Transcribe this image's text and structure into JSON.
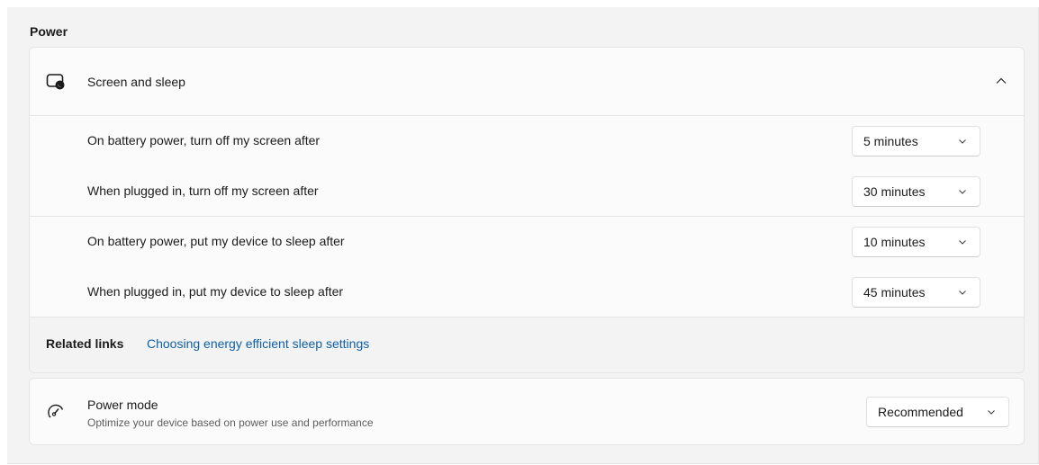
{
  "section": {
    "title": "Power"
  },
  "screen_sleep": {
    "label": "Screen and sleep",
    "header_icon": "screen-sleep-icon",
    "collapse_icon": "chevron-up-icon",
    "rows": [
      {
        "label": "On battery power, turn off my screen after",
        "value": "5 minutes"
      },
      {
        "label": "When plugged in, turn off my screen after",
        "value": "30 minutes"
      },
      {
        "label": "On battery power, put my device to sleep after",
        "value": "10 minutes"
      },
      {
        "label": "When plugged in, put my device to sleep after",
        "value": "45 minutes"
      }
    ],
    "related": {
      "title": "Related links",
      "link": "Choosing energy efficient sleep settings"
    }
  },
  "power_mode": {
    "title": "Power mode",
    "subtitle": "Optimize your device based on power use and performance",
    "value": "Recommended",
    "icon": "power-mode-gauge-icon"
  },
  "colors": {
    "background": "#f3f3f3",
    "card": "#fbfbfb",
    "link": "#0f5fa8",
    "text": "#1b1b1b",
    "secondary_text": "#5d5d5d"
  }
}
